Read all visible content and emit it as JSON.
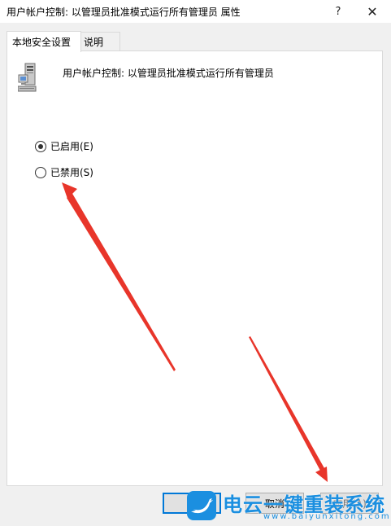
{
  "window": {
    "title": "用户帐户控制: 以管理员批准模式运行所有管理员 属性",
    "help_glyph": "?",
    "close_glyph": "✕"
  },
  "tabs": [
    {
      "label": "本地安全设置",
      "active": true
    },
    {
      "label": "说明",
      "active": false
    }
  ],
  "policy": {
    "icon": "server-computer-icon",
    "name": "用户帐户控制: 以管理员批准模式运行所有管理员"
  },
  "options": [
    {
      "label": "已启用(E)",
      "checked": true
    },
    {
      "label": "已禁用(S)",
      "checked": false
    }
  ],
  "buttons": {
    "ok": "",
    "cancel": "取消",
    "apply": "应用(A)"
  },
  "watermark": {
    "title": "电云一键重装系统",
    "url": "www.baiyunxitong.com"
  },
  "colors": {
    "arrow": "#e8352a",
    "watermark": "#1b8fe0",
    "focus_border": "#0078d7"
  }
}
